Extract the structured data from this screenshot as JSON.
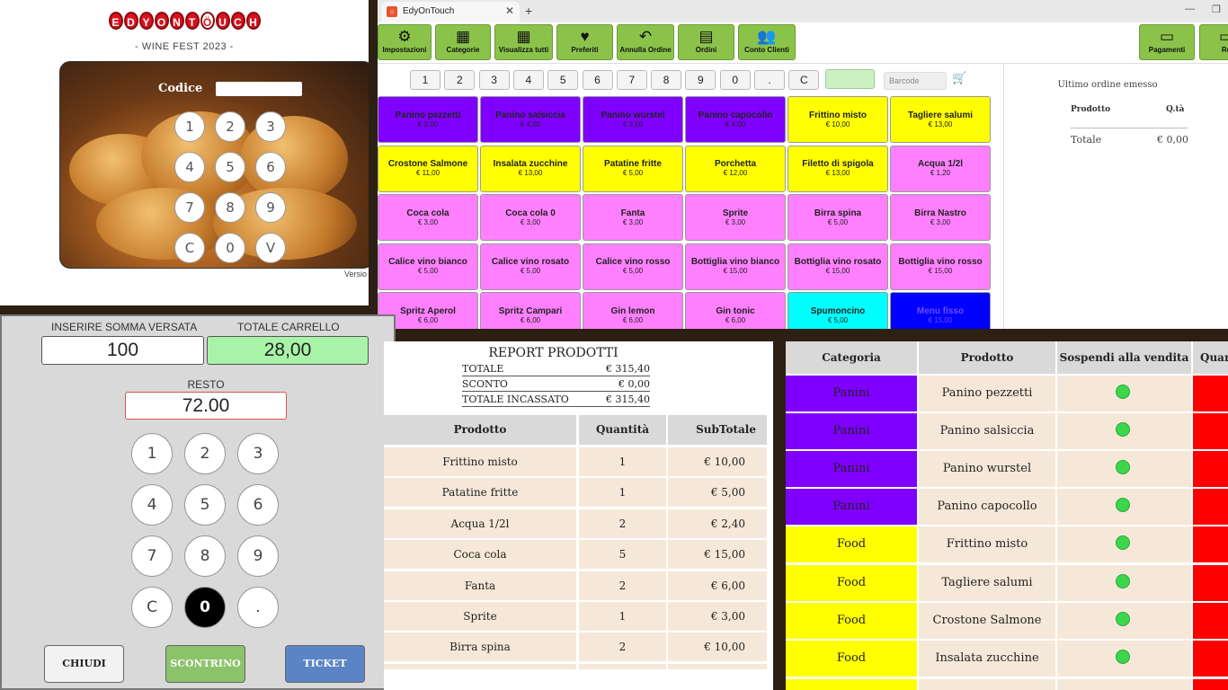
{
  "login": {
    "logo_letters": [
      "E",
      "D",
      "Y",
      "O",
      "N",
      "T",
      "Ö",
      "U",
      "C",
      "H"
    ],
    "event": "- WINE FEST 2023 -",
    "code_label": "Codice",
    "keys": [
      "1",
      "2",
      "3",
      "4",
      "5",
      "6",
      "7",
      "8",
      "9",
      "C",
      "0",
      "V"
    ],
    "version": "Versio"
  },
  "pos": {
    "tab_title": "EdyOnTouch",
    "toolbar": [
      {
        "label": "Impostazioni",
        "icon": "⚙"
      },
      {
        "label": "Categorie",
        "icon": "▦"
      },
      {
        "label": "Visualizza tutti",
        "icon": "▦"
      },
      {
        "label": "Preferiti",
        "icon": "♥"
      },
      {
        "label": "Annulla Ordine",
        "icon": "↶"
      },
      {
        "label": "Ordini",
        "icon": "▤"
      },
      {
        "label": "Conto Clienti",
        "icon": "👥"
      },
      {
        "label": "Pagamenti",
        "icon": "▭"
      },
      {
        "label": "Re",
        "icon": "▭"
      }
    ],
    "number_keys": [
      "1",
      "2",
      "3",
      "4",
      "5",
      "6",
      "7",
      "8",
      "9",
      "0",
      ".",
      "C"
    ],
    "barcode_placeholder": "Barcode",
    "products": [
      {
        "name": "Panino pezzetti",
        "price": "€ 3,00",
        "color": "#7f00ff"
      },
      {
        "name": "Panino salsiccia",
        "price": "€ 4,00",
        "color": "#7f00ff"
      },
      {
        "name": "Panino wurstel",
        "price": "€ 3,50",
        "color": "#7f00ff"
      },
      {
        "name": "Panino capocollo",
        "price": "€ 4,00",
        "color": "#7f00ff"
      },
      {
        "name": "Frittino misto",
        "price": "€ 10,00",
        "color": "#ffff00"
      },
      {
        "name": "Tagliere salumi",
        "price": "€ 13,00",
        "color": "#ffff00"
      },
      {
        "name": "Crostone Salmone",
        "price": "€ 11,00",
        "color": "#ffff00"
      },
      {
        "name": "Insalata zucchine",
        "price": "€ 13,00",
        "color": "#ffff00"
      },
      {
        "name": "Patatine fritte",
        "price": "€ 5,00",
        "color": "#ffff00"
      },
      {
        "name": "Porchetta",
        "price": "€ 12,00",
        "color": "#ffff00"
      },
      {
        "name": "Filetto di spigola",
        "price": "€ 13,00",
        "color": "#ffff00"
      },
      {
        "name": "Acqua 1/2l",
        "price": "€ 1,20",
        "color": "#ff80ff"
      },
      {
        "name": "Coca cola",
        "price": "€ 3,00",
        "color": "#ff80ff"
      },
      {
        "name": "Coca cola 0",
        "price": "€ 3,00",
        "color": "#ff80ff"
      },
      {
        "name": "Fanta",
        "price": "€ 3,00",
        "color": "#ff80ff"
      },
      {
        "name": "Sprite",
        "price": "€ 3,00",
        "color": "#ff80ff"
      },
      {
        "name": "Birra spina",
        "price": "€ 5,00",
        "color": "#ff80ff"
      },
      {
        "name": "Birra Nastro",
        "price": "€ 3,00",
        "color": "#ff80ff"
      },
      {
        "name": "Calice vino bianco",
        "price": "€ 5,00",
        "color": "#ff80ff"
      },
      {
        "name": "Calice vino rosato",
        "price": "€ 5,00",
        "color": "#ff80ff"
      },
      {
        "name": "Calice vino rosso",
        "price": "€ 5,00",
        "color": "#ff80ff"
      },
      {
        "name": "Bottiglia vino bianco",
        "price": "€ 15,00",
        "color": "#ff80ff"
      },
      {
        "name": "Bottiglia vino rosato",
        "price": "€ 15,00",
        "color": "#ff80ff"
      },
      {
        "name": "Bottiglia vino rosso",
        "price": "€ 15,00",
        "color": "#ff80ff"
      },
      {
        "name": "Spritz Aperol",
        "price": "€ 6,00",
        "color": "#ff80ff"
      },
      {
        "name": "Spritz Campari",
        "price": "€ 6,00",
        "color": "#ff80ff"
      },
      {
        "name": "Gin lemon",
        "price": "€ 6,00",
        "color": "#ff80ff"
      },
      {
        "name": "Gin tonic",
        "price": "€ 6,00",
        "color": "#ff80ff"
      },
      {
        "name": "Spumoncino",
        "price": "€ 5,00",
        "color": "#00ffff"
      },
      {
        "name": "Menu fisso",
        "price": "€ 15,00",
        "color": "#0000ff"
      }
    ],
    "order": {
      "title": "Ultimo ordine emesso",
      "col_product": "Prodotto",
      "col_qty": "Q.tà",
      "total_label": "Totale",
      "total_value": "€ 0,00"
    }
  },
  "payment": {
    "paid_label": "INSERIRE SOMMA VERSATA",
    "paid_value": "100",
    "cart_label": "TOTALE CARRELLO",
    "cart_value": "28,00",
    "change_label": "RESTO",
    "change_value": "72.00",
    "keys": [
      "1",
      "2",
      "3",
      "4",
      "5",
      "6",
      "7",
      "8",
      "9",
      "C",
      "0",
      "."
    ],
    "close_label": "CHIUDI",
    "receipt_label": "SCONTRINO",
    "ticket_label": "TICKET"
  },
  "report": {
    "title": "REPORT PRODOTTI",
    "summary": [
      {
        "label": "TOTALE",
        "value": "€ 315,40"
      },
      {
        "label": "SCONTO",
        "value": "€ 0,00"
      },
      {
        "label": "TOTALE INCASSATO",
        "value": "€ 315,40"
      }
    ],
    "columns": [
      "Prodotto",
      "Quantità",
      "SubTotale"
    ],
    "rows": [
      [
        "Frittino misto",
        "1",
        "€ 10,00"
      ],
      [
        "Patatine fritte",
        "1",
        "€ 5,00"
      ],
      [
        "Acqua 1/2l",
        "2",
        "€ 2,40"
      ],
      [
        "Coca cola",
        "5",
        "€ 15,00"
      ],
      [
        "Fanta",
        "2",
        "€ 6,00"
      ],
      [
        "Sprite",
        "1",
        "€ 3,00"
      ],
      [
        "Birra spina",
        "2",
        "€ 10,00"
      ]
    ]
  },
  "categories": {
    "columns": [
      "Categoria",
      "Prodotto",
      "Sospendi alla vendita",
      "Quan"
    ],
    "rows": [
      {
        "category": "Panini",
        "product": "Panino pezzetti",
        "color": "#7f00ff"
      },
      {
        "category": "Panini",
        "product": "Panino salsiccia",
        "color": "#7f00ff"
      },
      {
        "category": "Panini",
        "product": "Panino wurstel",
        "color": "#7f00ff"
      },
      {
        "category": "Panini",
        "product": "Panino capocollo",
        "color": "#7f00ff"
      },
      {
        "category": "Food",
        "product": "Frittino misto",
        "color": "#ffff00"
      },
      {
        "category": "Food",
        "product": "Tagliere salumi",
        "color": "#ffff00"
      },
      {
        "category": "Food",
        "product": "Crostone Salmone",
        "color": "#ffff00"
      },
      {
        "category": "Food",
        "product": "Insalata zucchine",
        "color": "#ffff00"
      }
    ],
    "status_color": "#3cd64c",
    "qty_color": "#ff0000"
  }
}
